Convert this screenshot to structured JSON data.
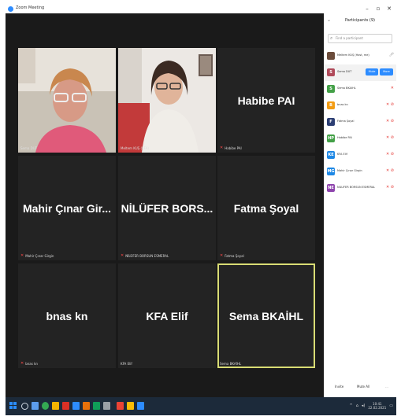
{
  "window": {
    "title": "Zoom Meeting"
  },
  "tiles": [
    {
      "name": "",
      "footer": "Sema DUT"
    },
    {
      "name": "",
      "footer": "Meltem KUŞ (KFA)"
    },
    {
      "name": "Habibe PAI",
      "footer": "Habibe PAI"
    },
    {
      "name": "Mahir Çınar Gir...",
      "footer": "Mahir Çınar Girgin"
    },
    {
      "name": "NİLÜFER BORS...",
      "footer": "NİLÜFER BORSUN ESMERAL"
    },
    {
      "name": "Fatma Şoyal",
      "footer": "Fatma Şoyal"
    },
    {
      "name": "bnas kn",
      "footer": "bnas kn"
    },
    {
      "name": "KFA Elif",
      "footer": "KFA Elif"
    },
    {
      "name": "Sema BKAİHL",
      "footer": "Sema BKAİHL"
    }
  ],
  "participants_panel": {
    "title": "Participants (9)",
    "search_placeholder": "Find a participant",
    "participants": [
      {
        "initial": "",
        "name": "Meltem KUŞ (Host, me)",
        "avatar_color": "#6b4c3b"
      },
      {
        "initial": "S",
        "name": "Sema DUT",
        "avatar_color": "#b04a5a"
      },
      {
        "initial": "S",
        "name": "Sema BKAİHL",
        "avatar_color": "#43a047"
      },
      {
        "initial": "B",
        "name": "bnas kn",
        "avatar_color": "#f39c12"
      },
      {
        "initial": "F",
        "name": "Fatma Şoyal",
        "avatar_color": "#2c3e73"
      },
      {
        "initial": "HP",
        "name": "Habibe PAI",
        "avatar_color": "#43a047"
      },
      {
        "initial": "KE",
        "name": "KFA Elif",
        "avatar_color": "#1e88e5"
      },
      {
        "initial": "MG",
        "name": "Mahir Çınar Girgin",
        "avatar_color": "#1e88e5"
      },
      {
        "initial": "NE",
        "name": "NİLÜFER BORSUN ESMERAL",
        "avatar_color": "#8e44ad"
      }
    ],
    "mute_label": "Mute",
    "more_label": "More",
    "footer": {
      "invite": "Invite",
      "mute_all": "Mute All"
    }
  },
  "taskbar": {
    "time": "10:41",
    "date": "22.02.2021"
  },
  "colors": {
    "zoom_blue": "#2d8cff",
    "muted_red": "#e53935",
    "active_speaker": "#d8dc74"
  }
}
